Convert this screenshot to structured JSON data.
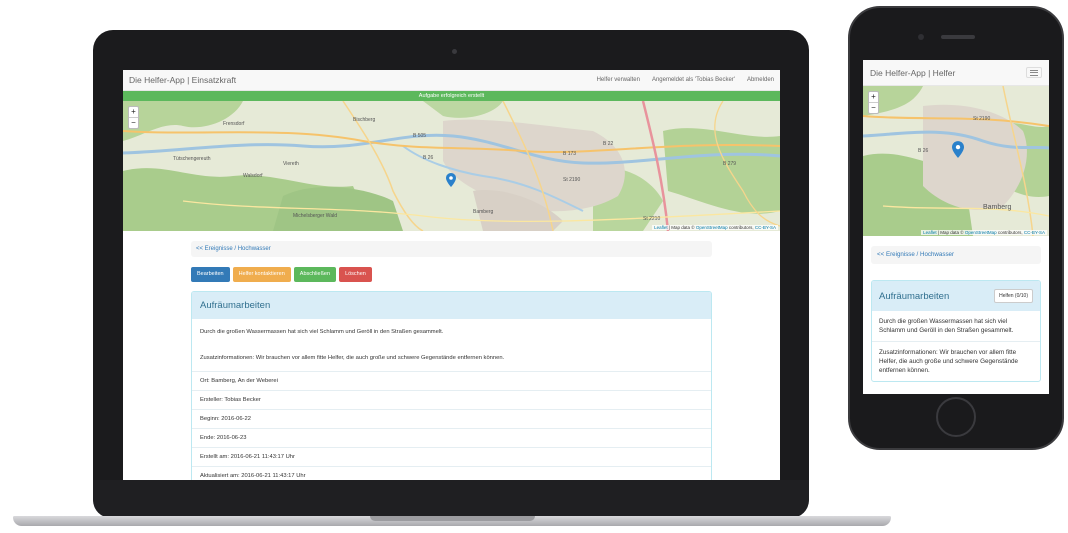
{
  "laptop": {
    "nav": {
      "brand": "Die Helfer-App | Einsatzkraft",
      "manage_helpers": "Helfer verwalten",
      "logged_in_as": "Angemeldet als 'Tobias Becker'",
      "logout": "Abmelden"
    },
    "alert": "Aufgabe erfolgreich erstellt",
    "map": {
      "zoom_in": "+",
      "zoom_out": "−",
      "attribution_leaflet": "Leaflet",
      "attribution_text": " | Map data © ",
      "attribution_osm": "OpenStreetMap",
      "attribution_contrib": " contributors, ",
      "attribution_license": "CC-BY-SA",
      "place_labels": [
        "Frensdorf",
        "Bischberg",
        "Tütschengereuth",
        "Walsdorf",
        "Viereth",
        "Bamberg",
        "Michelsberger Wald",
        "B 26",
        "B 22",
        "B 505",
        "B 173",
        "St 2190",
        "St 2210",
        "B 279"
      ]
    },
    "breadcrumb": "<< Ereignisse / Hochwasser",
    "buttons": {
      "edit": "Bearbeiten",
      "contact_helpers": "Helfer kontaktieren",
      "complete": "Abschließen",
      "delete": "Löschen"
    },
    "panel": {
      "title": "Aufräumarbeiten",
      "description": "Durch die großen Wassermassen hat sich viel Schlamm und Geröll in den Straßen gesammelt.",
      "additional_info": "Zusatzinformationen: Wir brauchen vor allem fitte Helfer, die auch große und schwere Gegenstände entfernen können.",
      "location": "Ort: Bamberg, An der Weberei",
      "creator": "Ersteller: Tobias Becker",
      "start": "Beginn: 2016-06-22",
      "end": "Ende: 2016-06-23",
      "created_at": "Erstellt am: 2016-06-21 11:43:17 Uhr",
      "updated_at": "Aktualisiert am: 2016-06-21 11:43:17 Uhr"
    }
  },
  "phone": {
    "nav": {
      "brand": "Die Helfer-App | Helfer",
      "menu_icon": "hamburger-menu-icon"
    },
    "map": {
      "zoom_in": "+",
      "zoom_out": "−",
      "attribution_leaflet": "Leaflet",
      "attribution_text": " | Map data © ",
      "attribution_osm": "OpenStreetMap",
      "attribution_contrib": " contributors, ",
      "attribution_license": "CC-BY-SA",
      "place_labels": [
        "Bamberg",
        "B 26",
        "St 2190"
      ]
    },
    "breadcrumb": "<< Ereignisse / Hochwasser",
    "panel": {
      "title": "Aufräumarbeiten",
      "help_button": "Helfen (0/10)",
      "description": "Durch die großen Wassermassen hat sich viel Schlamm und Geröll in den Straßen gesammelt.",
      "additional_info": "Zusatzinformationen: Wir brauchen vor allem fitte Helfer, die auch große und schwere Gegenstände entfernen können."
    }
  },
  "colors": {
    "primary": "#337ab7",
    "warning": "#f0ad4e",
    "success": "#5cb85c",
    "danger": "#d9534f",
    "panel_heading": "#d9edf7",
    "map_pin": "#2a81cb"
  }
}
